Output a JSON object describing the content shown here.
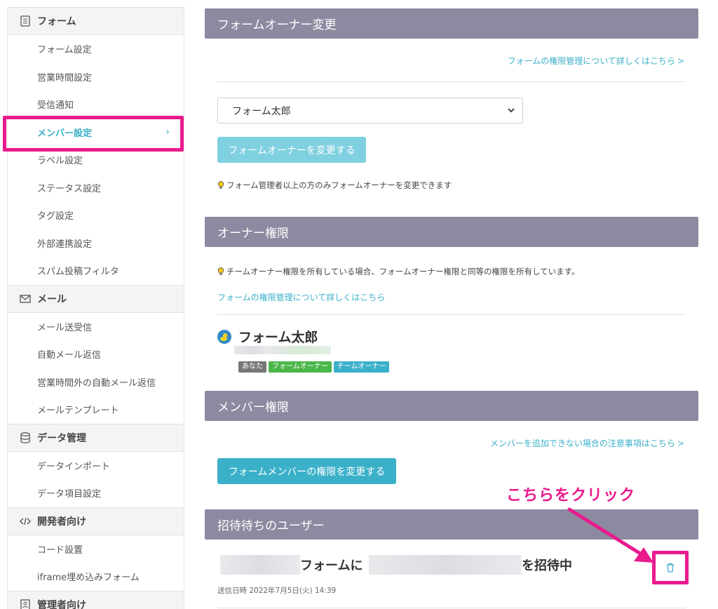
{
  "sidebar": {
    "sections": [
      {
        "label": "フォーム",
        "icon": "document-icon"
      },
      {
        "label": "メール",
        "icon": "mail-icon"
      },
      {
        "label": "データ管理",
        "icon": "database-icon"
      },
      {
        "label": "開発者向け",
        "icon": "code-icon"
      },
      {
        "label": "管理者向け",
        "icon": "admin-icon"
      }
    ],
    "form_items": [
      "フォーム設定",
      "営業時間設定",
      "受信通知",
      "メンバー設定",
      "ラベル設定",
      "ステータス設定",
      "タグ設定",
      "外部連携設定",
      "スパム投稿フィルタ"
    ],
    "mail_items": [
      "メール送受信",
      "自動メール返信",
      "営業時間外の自動メール返信",
      "メールテンプレート"
    ],
    "data_items": [
      "データインポート",
      "データ項目設定"
    ],
    "dev_items": [
      "コード設置",
      "iframe埋め込みフォーム"
    ],
    "active_chevron": "›"
  },
  "owner_change": {
    "title": "フォームオーナー変更",
    "help_link": "フォームの権限管理について詳しくはこちら",
    "link_arrow": ">",
    "select_value": "フォーム太郎",
    "button": "フォームオーナーを変更する",
    "note": "フォーム管理者以上の方のみフォームオーナーを変更できます"
  },
  "owner_auth": {
    "title": "オーナー権限",
    "note": "チームオーナー権限を所有している場合、フォームオーナー権限と同等の権限を所有しています。",
    "help_link": "フォームの権限管理について詳しくはこちら",
    "user_name": "フォーム太郎",
    "badges": [
      "あなた",
      "フォームオーナー",
      "チームオーナー"
    ]
  },
  "member_auth": {
    "title": "メンバー権限",
    "help_link": "メンバーを追加できない場合の注意事項はこちら",
    "button": "フォームメンバーの権限を変更する"
  },
  "invites": {
    "title": "招待待ちのユーザー",
    "text_mid": "フォームに",
    "text_end": "を招待中",
    "sent": "送信日時 2022年7月5日(火) 14:39"
  },
  "callout": "こちらをクリック",
  "colors": {
    "accent": "#3bb0c9",
    "highlight": "#ea1b8e",
    "header": "#8c8aa0"
  }
}
